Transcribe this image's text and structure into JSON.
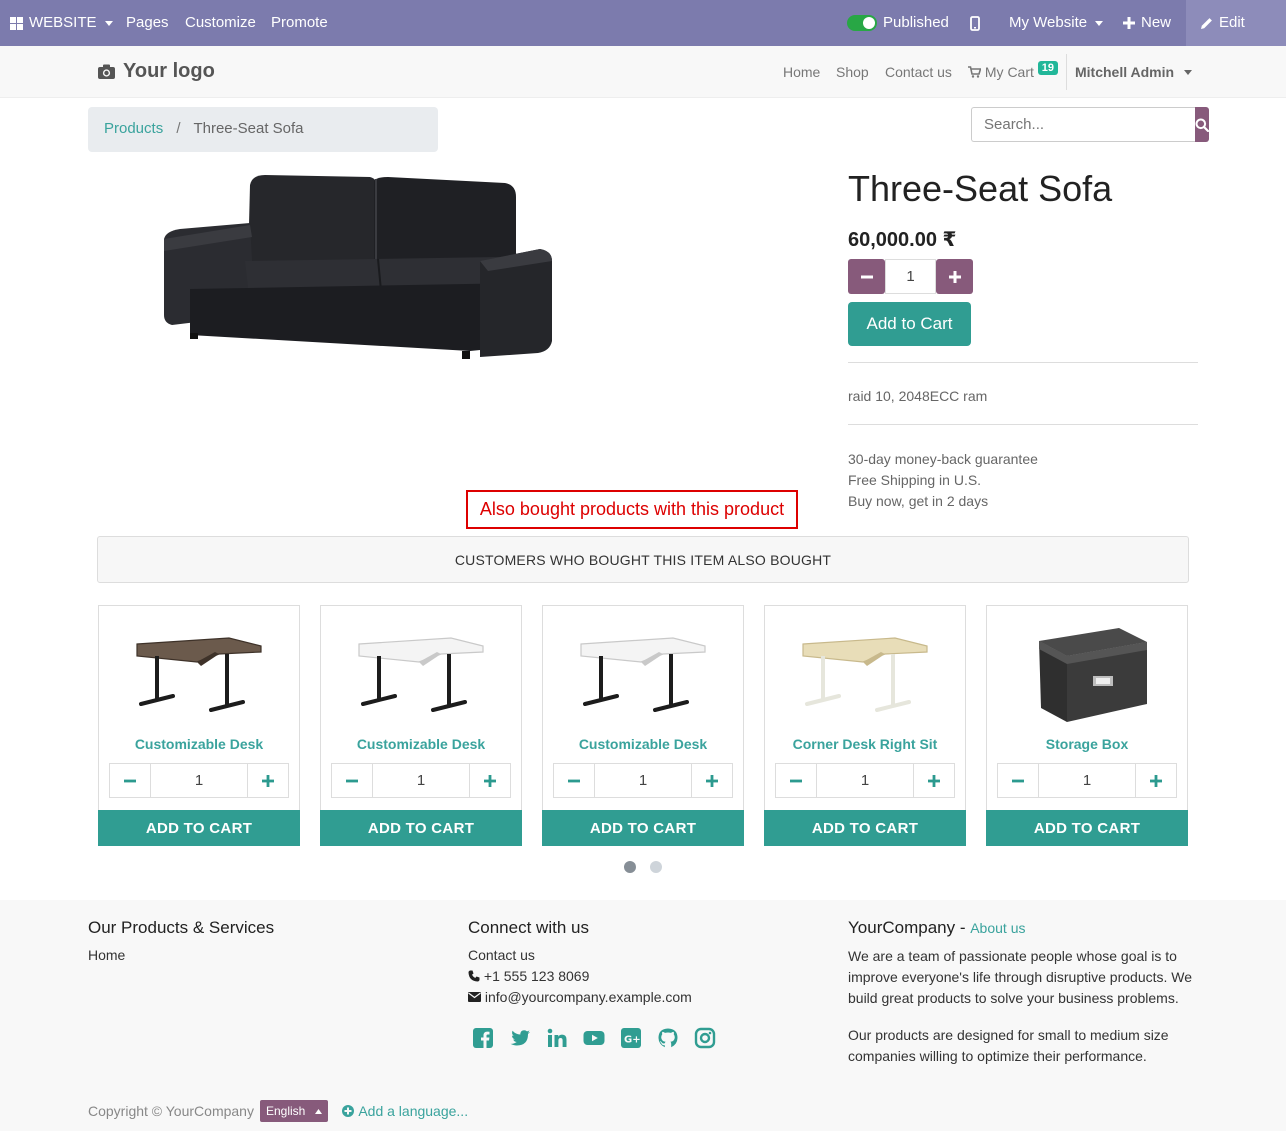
{
  "adminbar": {
    "website": "WEBSITE",
    "pages": "Pages",
    "customize": "Customize",
    "promote": "Promote",
    "published": "Published",
    "my_website": "My Website",
    "new": "New",
    "edit": "Edit"
  },
  "header": {
    "logo": "Your logo",
    "nav": {
      "home": "Home",
      "shop": "Shop",
      "contact": "Contact us",
      "cart": "My Cart",
      "cart_count": "19",
      "user": "Mitchell Admin"
    }
  },
  "breadcrumb": {
    "parent": "Products",
    "separator": "/",
    "current": "Three-Seat Sofa"
  },
  "search": {
    "placeholder": "Search..."
  },
  "product": {
    "name": "Three-Seat Sofa",
    "price": "60,000.00 ₹",
    "quantity": "1",
    "add_to_cart": "Add to Cart",
    "description": "raid 10, 2048ECC ram",
    "guarantee": [
      "30-day money-back guarantee",
      "Free Shipping in U.S.",
      "Buy now, get in 2 days"
    ]
  },
  "annotation": "Also bought products with this product",
  "also_bought": {
    "header": "CUSTOMERS WHO BOUGHT THIS ITEM ALSO BOUGHT",
    "items": [
      {
        "name": "Customizable Desk",
        "qty": "1",
        "cart": "ADD TO CART",
        "icon": "desk-dark"
      },
      {
        "name": "Customizable Desk",
        "qty": "1",
        "cart": "ADD TO CART",
        "icon": "desk-white"
      },
      {
        "name": "Customizable Desk",
        "qty": "1",
        "cart": "ADD TO CART",
        "icon": "desk-white"
      },
      {
        "name": "Corner Desk Right Sit",
        "qty": "1",
        "cart": "ADD TO CART",
        "icon": "desk-birch"
      },
      {
        "name": "Storage Box",
        "qty": "1",
        "cart": "ADD TO CART",
        "icon": "storage-box"
      }
    ]
  },
  "footer": {
    "products_title": "Our Products & Services",
    "products_home": "Home",
    "connect_title": "Connect with us",
    "contact_link": "Contact us",
    "phone": "+1 555 123 8069",
    "email": "info@yourcompany.example.com",
    "company_name": "YourCompany",
    "company_dash": " - ",
    "about_link": "About us",
    "about_text_1": "We are a team of passionate people whose goal is to improve everyone's life through disruptive products. We build great products to solve your business problems.",
    "about_text_2": "Our products are designed for small to medium size companies willing to optimize their performance.",
    "copyright": "Copyright © YourCompany",
    "language": "English",
    "add_language": "Add a language..."
  },
  "colors": {
    "admin_bar": "#7c7bad",
    "primary_purple": "#875A7B",
    "teal": "#309d92",
    "link": "#3aa39d",
    "annotation": "#dd0000"
  }
}
